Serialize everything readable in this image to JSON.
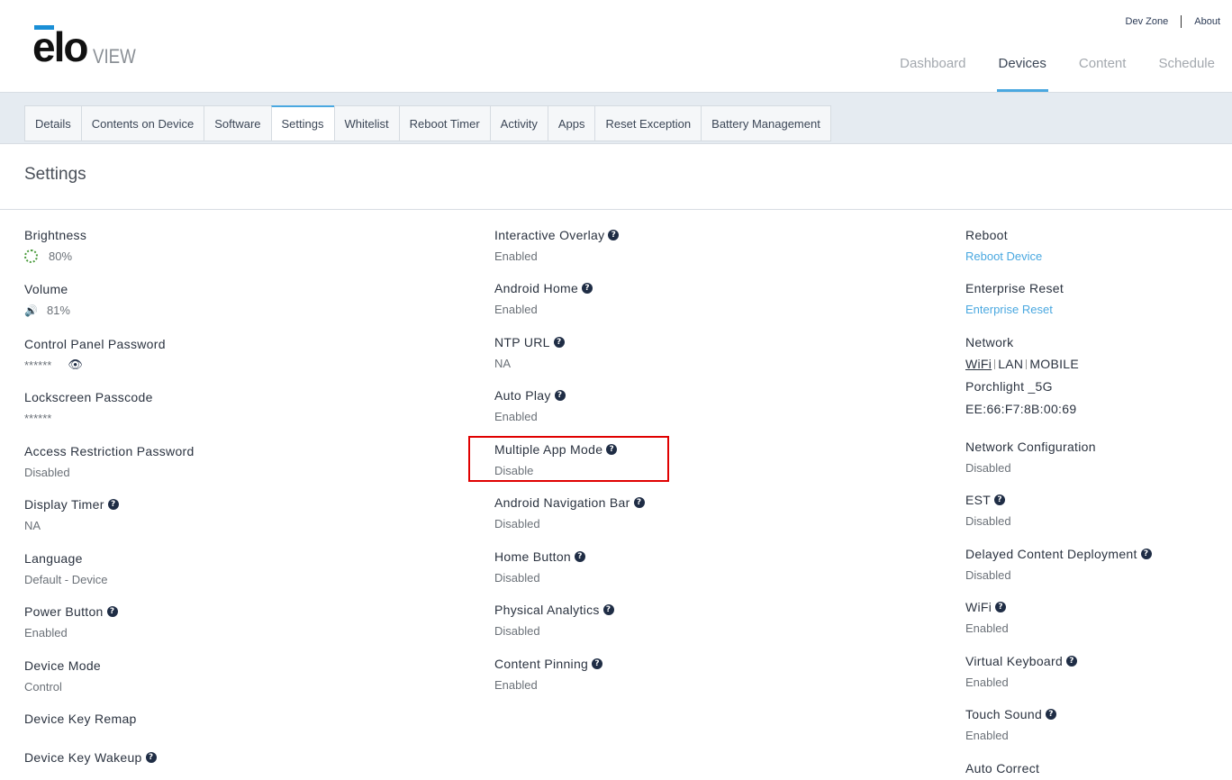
{
  "brand": {
    "logo_main": "elo",
    "logo_sub": "VIEW"
  },
  "top_links": {
    "dev_zone": "Dev Zone",
    "about": "About"
  },
  "main_nav": [
    {
      "label": "Dashboard"
    },
    {
      "label": "Devices",
      "active": true
    },
    {
      "label": "Content"
    },
    {
      "label": "Schedule"
    }
  ],
  "tabs": [
    "Details",
    "Contents on Device",
    "Software",
    "Settings",
    "Whitelist",
    "Reboot Timer",
    "Activity",
    "Apps",
    "Reset Exception",
    "Battery Management"
  ],
  "active_tab": "Settings",
  "page_title": "Settings",
  "col1": {
    "brightness": {
      "label": "Brightness",
      "value": "80%"
    },
    "volume": {
      "label": "Volume",
      "value": "81%"
    },
    "cp_password": {
      "label": "Control Panel Password",
      "value": "******"
    },
    "lockscreen": {
      "label": "Lockscreen Passcode",
      "value": "******"
    },
    "access": {
      "label": "Access Restriction Password",
      "value": "Disabled"
    },
    "display_timer": {
      "label": "Display Timer",
      "value": "NA"
    },
    "language": {
      "label": "Language",
      "value": "Default - Device"
    },
    "power": {
      "label": "Power Button",
      "value": "Enabled"
    },
    "device_mode": {
      "label": "Device Mode",
      "value": "Control"
    },
    "key_remap": {
      "label": "Device Key Remap"
    },
    "key_wakeup": {
      "label": "Device Key Wakeup"
    }
  },
  "col2": {
    "overlay": {
      "label": "Interactive Overlay",
      "value": "Enabled"
    },
    "android_home": {
      "label": "Android Home",
      "value": "Enabled"
    },
    "ntp": {
      "label": "NTP URL",
      "value": "NA"
    },
    "autoplay": {
      "label": "Auto Play",
      "value": "Enabled"
    },
    "multi_app": {
      "label": "Multiple App Mode",
      "value": "Disable"
    },
    "nav_bar": {
      "label": "Android Navigation Bar",
      "value": "Disabled"
    },
    "home_button": {
      "label": "Home Button",
      "value": "Disabled"
    },
    "analytics": {
      "label": "Physical Analytics",
      "value": "Disabled"
    },
    "pinning": {
      "label": "Content Pinning",
      "value": "Enabled"
    }
  },
  "col3": {
    "reboot": {
      "label": "Reboot",
      "value": "Reboot Device"
    },
    "ent_reset": {
      "label": "Enterprise Reset",
      "value": "Enterprise Reset"
    },
    "network": {
      "label": "Network",
      "wifi": "WiFi",
      "lan": "LAN",
      "mobile": "MOBILE",
      "ssid": "Porchlight _5G",
      "mac": "EE:66:F7:8B:00:69"
    },
    "net_config": {
      "label": "Network Configuration",
      "value": "Disabled"
    },
    "est": {
      "label": "EST",
      "value": "Disabled"
    },
    "delayed": {
      "label": "Delayed Content Deployment",
      "value": "Disabled"
    },
    "wifi": {
      "label": "WiFi",
      "value": "Enabled"
    },
    "vkeyboard": {
      "label": "Virtual Keyboard",
      "value": "Enabled"
    },
    "touch_sound": {
      "label": "Touch Sound",
      "value": "Enabled"
    },
    "autocorrect": {
      "label": "Auto Correct"
    }
  },
  "icons": {
    "help": "?",
    "eye": "👁",
    "speaker": "🔊"
  },
  "colors": {
    "accent": "#4aa8e0",
    "highlight": "#e00000",
    "green": "#4a9b3c"
  }
}
